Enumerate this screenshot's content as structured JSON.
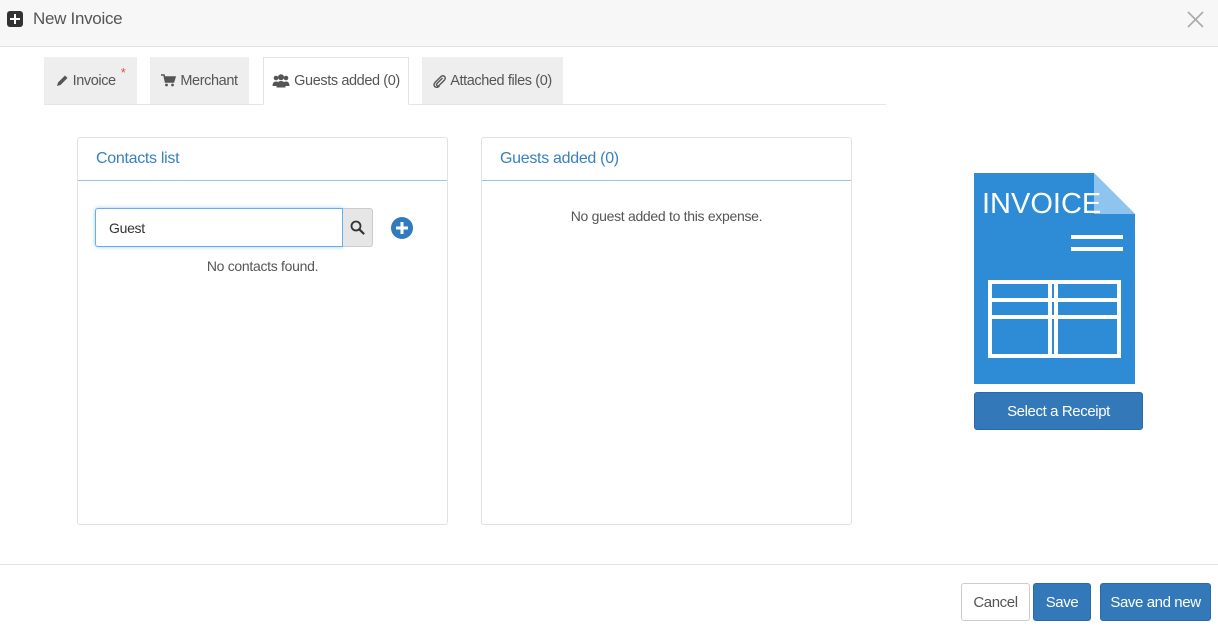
{
  "header": {
    "title": "New Invoice",
    "icon": "plus-square-icon",
    "close_icon": "close-icon"
  },
  "tabs": [
    {
      "label": "Invoice",
      "icon": "pencil-icon",
      "required_mark": "*"
    },
    {
      "label": "Merchant",
      "icon": "cart-icon"
    },
    {
      "label": "Guests added (0)",
      "icon": "users-icon",
      "active": true
    },
    {
      "label": "Attached files (0)",
      "icon": "paperclip-icon"
    }
  ],
  "contacts_panel": {
    "title": "Contacts list",
    "search_value": "Guest",
    "search_icon": "search-icon",
    "add_icon": "plus-circle-icon",
    "empty_message": "No contacts found."
  },
  "guests_panel": {
    "title": "Guests added (0)",
    "empty_message": "No guest added to this expense."
  },
  "receipt": {
    "image_text": "INVOICE",
    "button_label": "Select a Receipt"
  },
  "footer": {
    "cancel_label": "Cancel",
    "save_label": "Save",
    "save_new_label": "Save and new"
  },
  "colors": {
    "primary": "#3378b9",
    "link_blue": "#3a80c1",
    "invoice_blue": "#2e8bd5",
    "required": "#e74c3c"
  }
}
